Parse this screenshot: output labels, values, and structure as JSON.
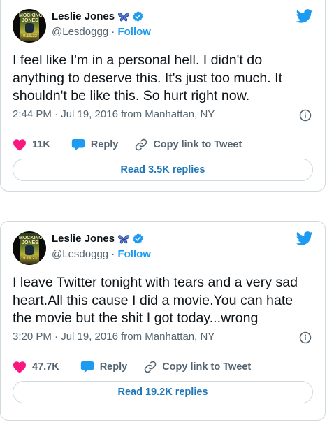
{
  "colors": {
    "accent": "#1d9bf0",
    "like": "#f91880",
    "text": "#0f1419",
    "muted": "#536471"
  },
  "tweets": [
    {
      "author": {
        "name": "Leslie Jones",
        "handle": "@Lesdoggg",
        "follow_label": "Follow",
        "avatar_text_top": "MOCKING JONES",
        "avatar_text_bottom": "9.19.23"
      },
      "text": [
        "I feel like I'm in a personal hell. I didn't do",
        "anything to deserve this. It's just too much. It",
        "shouldn't be like this. So hurt right now."
      ],
      "meta": "2:44 PM · Jul 19, 2016 from Manhattan, NY",
      "likes": "11K",
      "reply_label": "Reply",
      "copy_label": "Copy link to Tweet",
      "read_replies": "Read 3.5K replies",
      "icons": [
        "butterfly-icon",
        "verified-icon",
        "twitter-bird-icon",
        "info-icon",
        "heart-icon",
        "reply-bubble-icon",
        "link-icon"
      ]
    },
    {
      "author": {
        "name": "Leslie Jones",
        "handle": "@Lesdoggg",
        "follow_label": "Follow",
        "avatar_text_top": "MOCKING JONES",
        "avatar_text_bottom": "9.19.23"
      },
      "text": [
        "I leave Twitter tonight with tears and a very sad",
        "heart.All this cause I did a movie.You can hate",
        "the movie but the shit I got today...wrong"
      ],
      "meta": "3:20 PM · Jul 19, 2016 from Manhattan, NY",
      "likes": "47.7K",
      "reply_label": "Reply",
      "copy_label": "Copy link to Tweet",
      "read_replies": "Read 19.2K replies",
      "icons": [
        "butterfly-icon",
        "verified-icon",
        "twitter-bird-icon",
        "info-icon",
        "heart-icon",
        "reply-bubble-icon",
        "link-icon"
      ]
    }
  ]
}
